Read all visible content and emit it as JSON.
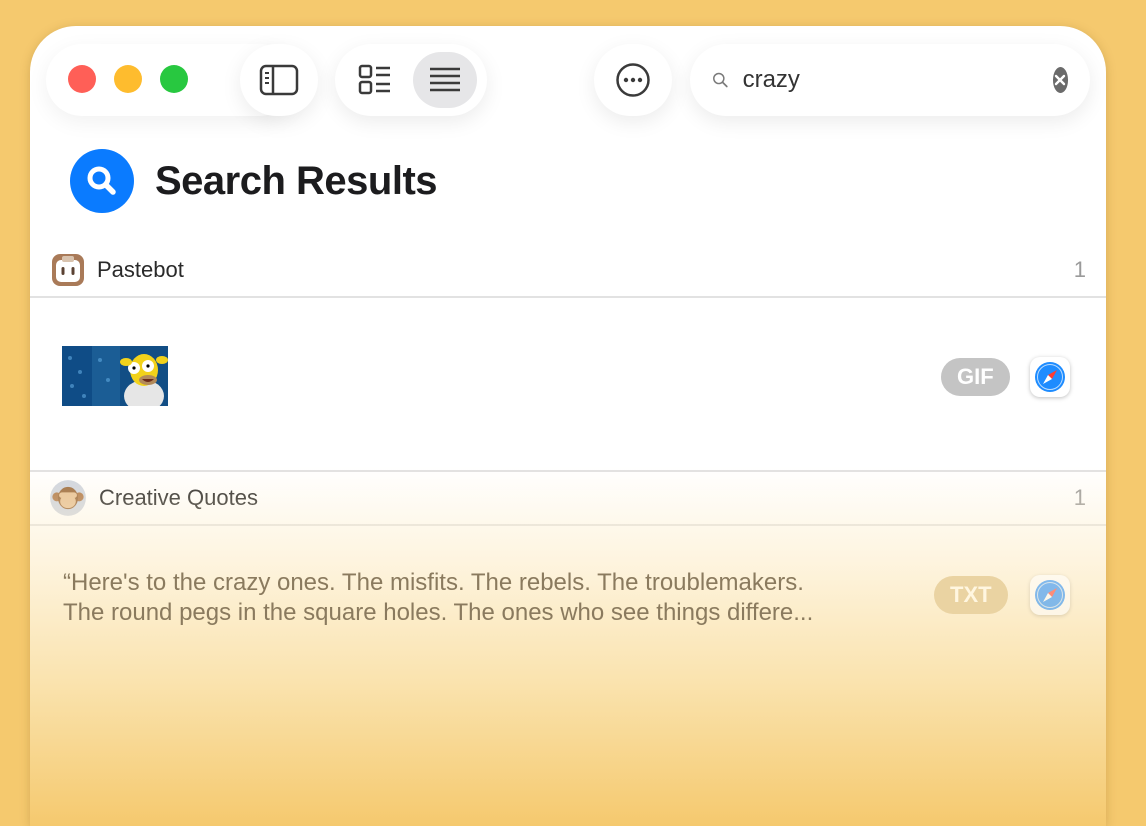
{
  "window": {
    "traffic_lights": [
      "close",
      "minimize",
      "zoom"
    ]
  },
  "toolbar": {
    "sidebar_icon": "sidebar-icon",
    "view_icons": [
      "grid-list-icon",
      "list-icon"
    ],
    "more_icon": "ellipsis-circle-icon",
    "search": {
      "value": "crazy",
      "placeholder": "",
      "icon": "search-icon",
      "clear_icon": "clear-icon"
    }
  },
  "main": {
    "title": "Search Results",
    "title_icon": "magnifier-icon",
    "sections": [
      {
        "name": "Pastebot",
        "count": "1",
        "icon": "pastebot-app-icon",
        "items": [
          {
            "kind": "image",
            "thumbnail": "homer-simpson-gif",
            "badge": "GIF",
            "source_icon": "safari-icon"
          }
        ]
      },
      {
        "name": "Creative Quotes",
        "count": "1",
        "icon": "monkey-emoji",
        "items": [
          {
            "kind": "text",
            "line1": "“Here's to the crazy ones. The misfits. The rebels. The troublemakers.",
            "line2": "The round pegs in the square holes. The ones who see things differe...",
            "badge": "TXT",
            "source_icon": "safari-icon"
          }
        ]
      }
    ]
  },
  "colors": {
    "accent": "#0a7bff",
    "background": "#f5c96e",
    "close": "#ff5f57",
    "minimize": "#febc2e",
    "zoom": "#28c840"
  }
}
